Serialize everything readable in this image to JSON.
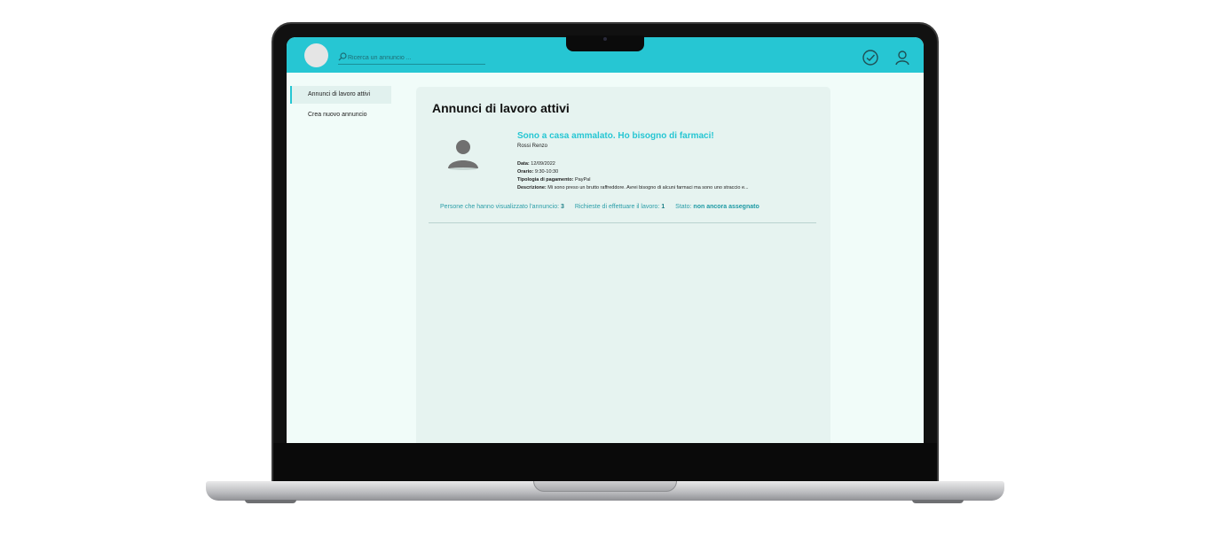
{
  "header": {
    "search_placeholder": "Ricerca un annuncio ...",
    "accent_color": "#26c6d3",
    "icons": [
      "search-icon",
      "check-circle-icon",
      "user-icon"
    ]
  },
  "sidebar": {
    "items": [
      {
        "label": "Annunci di lavoro attivi",
        "active": true
      },
      {
        "label": "Crea nuovo annuncio",
        "active": false
      }
    ]
  },
  "main": {
    "title": "Annunci di lavoro attivi",
    "listings": [
      {
        "title": "Sono a casa ammalato. Ho bisogno di farmaci!",
        "author": "Rossi Renzo",
        "date_label": "Data:",
        "date": "12/09/2022",
        "time_label": "Orario:",
        "time": "9:30-10:30",
        "payment_label": "Tipologia di pagamento:",
        "payment": "PayPal",
        "description_label": "Descrizione:",
        "description": "Mi sono preso un brutto raffreddore. Avrei bisogno di alcuni farmaci ma sono uno straccio e...",
        "views_label": "Persone che hanno visualizzato l'annuncio:",
        "views": "3",
        "requests_label": "Richieste di effettuare il lavoro:",
        "requests": "1",
        "status_label": "Stato:",
        "status": "non ancora assegnato"
      }
    ]
  }
}
